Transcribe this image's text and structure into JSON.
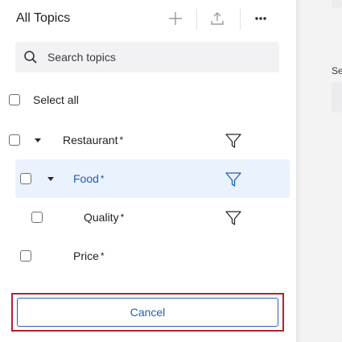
{
  "header": {
    "title": "All Topics"
  },
  "search": {
    "placeholder": "Search topics"
  },
  "select_all": {
    "label": "Select all"
  },
  "topics": [
    {
      "label": "Restaurant",
      "marker": "*"
    },
    {
      "label": "Food",
      "marker": "*"
    },
    {
      "label": "Quality",
      "marker": "*"
    },
    {
      "label": "Price",
      "marker": "*"
    }
  ],
  "footer": {
    "cancel_label": "Cancel"
  },
  "right_pane": {
    "label_fragment": "Se"
  },
  "colors": {
    "accent": "#1f5fb8",
    "highlight_row": "#eaf2fd",
    "focus_outline": "#b5202e"
  },
  "icons": [
    "plus-icon",
    "upload-icon",
    "more-icon",
    "search-icon",
    "caret-down-icon",
    "filter-icon"
  ]
}
